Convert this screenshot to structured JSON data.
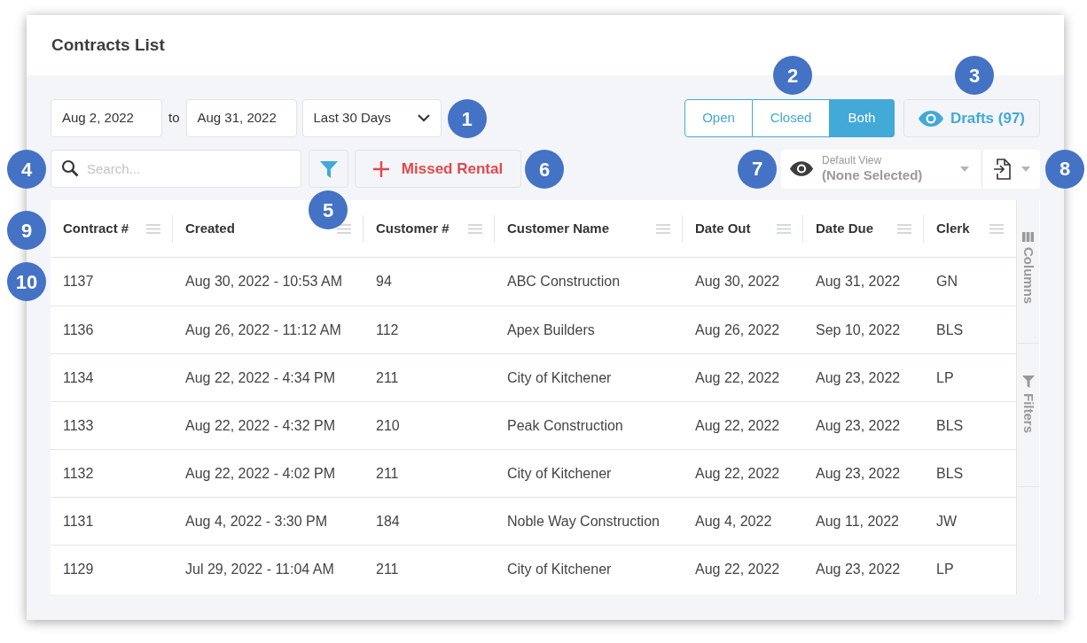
{
  "title": "Contracts List",
  "date_range": {
    "from": "Aug 2, 2022",
    "separator": "to",
    "to": "Aug 31, 2022",
    "preset": "Last 30 Days",
    "callout": "1"
  },
  "status_filter": {
    "callout": "2",
    "options": [
      {
        "label": "Open",
        "selected": false
      },
      {
        "label": "Closed",
        "selected": false
      },
      {
        "label": "Both",
        "selected": true
      }
    ]
  },
  "drafts_button": {
    "label": "Drafts (97)",
    "callout": "3"
  },
  "search": {
    "placeholder": "Search...",
    "callout": "4"
  },
  "filter_button": {
    "callout": "5"
  },
  "missed_rental_button": {
    "label": "Missed Rental",
    "callout": "6"
  },
  "view_selector": {
    "caption": "Default View",
    "value": "(None Selected)",
    "callout": "7"
  },
  "export_button": {
    "callout": "8"
  },
  "table": {
    "header_callout": "9",
    "row_callout": "10",
    "columns": [
      "Contract #",
      "Created",
      "Customer #",
      "Customer Name",
      "Date Out",
      "Date Due",
      "Clerk"
    ],
    "rows": [
      [
        "1137",
        "Aug 30, 2022 - 10:53 AM",
        "94",
        "ABC Construction",
        "Aug 30, 2022",
        "Aug 31, 2022",
        "GN"
      ],
      [
        "1136",
        "Aug 26, 2022 - 11:12 AM",
        "112",
        "Apex Builders",
        "Aug 26, 2022",
        "Sep 10, 2022",
        "BLS"
      ],
      [
        "1134",
        "Aug 22, 2022 - 4:34 PM",
        "211",
        "City of Kitchener",
        "Aug 22, 2022",
        "Aug 23, 2022",
        "LP"
      ],
      [
        "1133",
        "Aug 22, 2022 - 4:32 PM",
        "210",
        "Peak Construction",
        "Aug 22, 2022",
        "Aug 23, 2022",
        "BLS"
      ],
      [
        "1132",
        "Aug 22, 2022 - 4:02 PM",
        "211",
        "City of Kitchener",
        "Aug 22, 2022",
        "Aug 23, 2022",
        "BLS"
      ],
      [
        "1131",
        "Aug 4, 2022 - 3:30 PM",
        "184",
        "Noble Way Construction",
        "Aug 4, 2022",
        "Aug 11, 2022",
        "JW"
      ],
      [
        "1129",
        "Jul 29, 2022 - 11:04 AM",
        "211",
        "City of Kitchener",
        "Aug 22, 2022",
        "Aug 23, 2022",
        "LP"
      ]
    ]
  },
  "side_panel": {
    "tabs": [
      {
        "label": "Columns",
        "kind": "columns"
      },
      {
        "label": "Filters",
        "kind": "filters"
      }
    ]
  }
}
